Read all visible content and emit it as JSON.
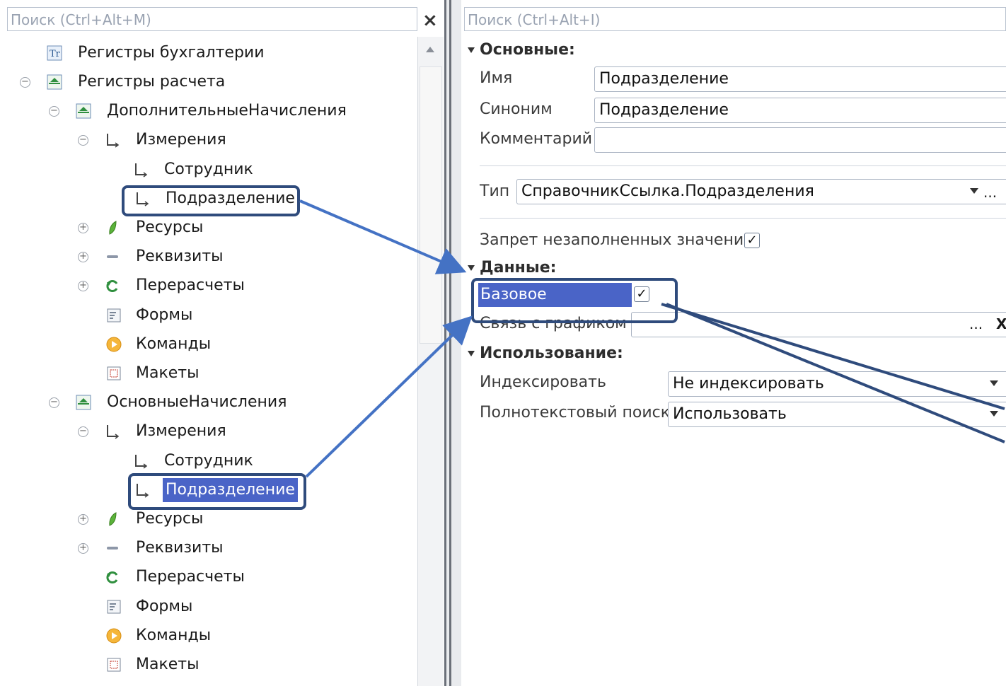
{
  "left": {
    "search_placeholder": "Поиск (Ctrl+Alt+M)",
    "close_glyph": "×",
    "tree": {
      "reg_buh": "Регистры бухгалтерии",
      "reg_rasch": "Регистры расчета",
      "dop": "ДополнительныеНачисления",
      "dop_izm": "Измерения",
      "dop_sotr": "Сотрудник",
      "dop_podr": "Подразделение",
      "dop_res": "Ресурсы",
      "dop_rekv": "Реквизиты",
      "dop_pere": "Перерасчеты",
      "dop_formy": "Формы",
      "dop_kom": "Команды",
      "dop_mak": "Макеты",
      "osn": "ОсновныеНачисления",
      "osn_izm": "Измерения",
      "osn_sotr": "Сотрудник",
      "osn_podr": "Подразделение",
      "osn_res": "Ресурсы",
      "osn_rekv": "Реквизиты",
      "osn_pere": "Перерасчеты",
      "osn_formy": "Формы",
      "osn_kom": "Команды",
      "osn_mak": "Макеты"
    }
  },
  "right": {
    "search_placeholder": "Поиск (Ctrl+Alt+I)",
    "sec_main": "Основные",
    "name_label": "Имя",
    "name_value": "Подразделение",
    "syn_label": "Синоним",
    "syn_value": "Подразделение",
    "comment_label": "Комментарий",
    "comment_value": "",
    "type_label": "Тип",
    "type_value": "СправочникСсылка.Подразделения",
    "deny_empty_label": "Запрет незаполненных значений",
    "sec_data": "Данные",
    "base_label": "Базовое",
    "link_label": "Связь с графиком",
    "sec_use": "Использование",
    "index_label": "Индексировать",
    "index_value": "Не индексировать",
    "fts_label": "Полнотекстовый поиск",
    "fts_value": "Использовать",
    "checkmark": "✓",
    "ellipsis": "...",
    "clear": "X"
  },
  "colors": {
    "arrow": "#4472c4",
    "highlight_border": "#2f4b7c",
    "selection": "#4a64c7"
  }
}
